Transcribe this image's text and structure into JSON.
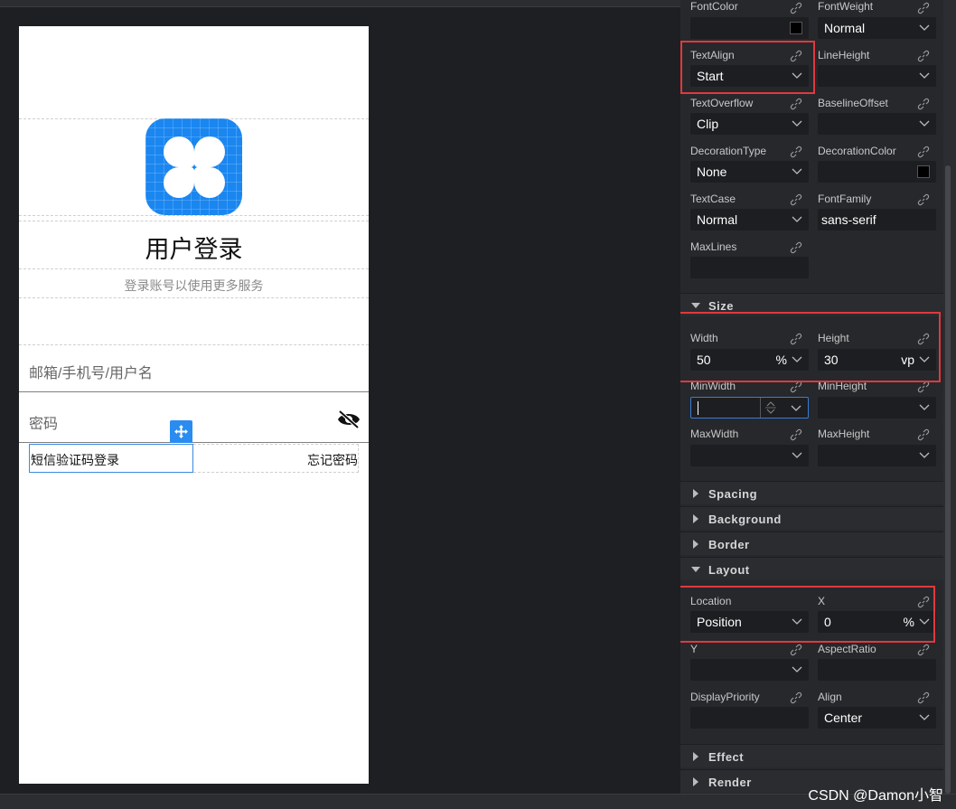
{
  "canvas": {
    "title": "用户登录",
    "subtitle": "登录账号以使用更多服务",
    "username_placeholder": "邮箱/手机号/用户名",
    "password_placeholder": "密码",
    "sms_login": "短信验证码登录",
    "forgot_password": "忘记密码",
    "icon_color": "#1a86f0"
  },
  "panel": {
    "text": {
      "fontcolor_label": "FontColor",
      "fontweight_label": "FontWeight",
      "fontweight_value": "Normal",
      "textalign_label": "TextAlign",
      "textalign_value": "Start",
      "lineheight_label": "LineHeight",
      "textoverflow_label": "TextOverflow",
      "textoverflow_value": "Clip",
      "baselineoffset_label": "BaselineOffset",
      "decorationtype_label": "DecorationType",
      "decorationtype_value": "None",
      "decorationcolor_label": "DecorationColor",
      "textcase_label": "TextCase",
      "textcase_value": "Normal",
      "fontfamily_label": "FontFamily",
      "fontfamily_value": "sans-serif",
      "maxlines_label": "MaxLines"
    },
    "sections": {
      "size": "Size",
      "spacing": "Spacing",
      "background": "Background",
      "border": "Border",
      "layout": "Layout",
      "effect": "Effect",
      "render": "Render"
    },
    "size": {
      "width_label": "Width",
      "width_value": "50",
      "width_unit": "%",
      "height_label": "Height",
      "height_value": "30",
      "height_unit": "vp",
      "minwidth_label": "MinWidth",
      "minheight_label": "MinHeight",
      "maxwidth_label": "MaxWidth",
      "maxheight_label": "MaxHeight"
    },
    "layout": {
      "location_label": "Location",
      "location_value": "Position",
      "x_label": "X",
      "x_value": "0",
      "x_unit": "%",
      "y_label": "Y",
      "aspectratio_label": "AspectRatio",
      "displaypriority_label": "DisplayPriority",
      "align_label": "Align",
      "align_value": "Center"
    }
  },
  "watermark": "CSDN @Damon小智",
  "colors": {
    "highlight": "#e0393e",
    "accent": "#2a8cf0"
  }
}
